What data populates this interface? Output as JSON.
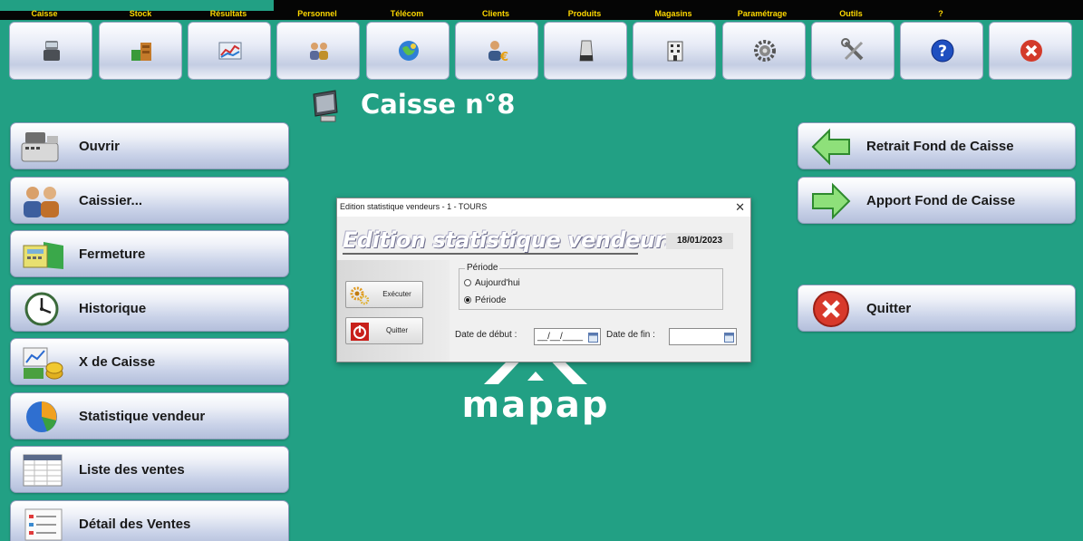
{
  "menu": [
    "Caisse",
    "Stock",
    "Résultats",
    "Personnel",
    "Télécom",
    "Clients",
    "Produits",
    "Magasins",
    "Paramétrage",
    "Outils",
    "?"
  ],
  "toolbar_icons": [
    "register-icon",
    "boxes-icon",
    "chart-icon",
    "people-icon",
    "globe-icon",
    "customer-euro-icon",
    "product-icon",
    "store-icon",
    "gear-icon",
    "tools-icon",
    "help-icon",
    "close-icon"
  ],
  "page_title": "Caisse n°8",
  "left_buttons": [
    {
      "label": "Ouvrir",
      "icon": "cash-register-icon"
    },
    {
      "label": "Caissier...",
      "icon": "cashiers-icon"
    },
    {
      "label": "Fermeture",
      "icon": "calculator-folder-icon"
    },
    {
      "label": "Historique",
      "icon": "clock-icon"
    },
    {
      "label": "X de Caisse",
      "icon": "money-chart-icon"
    },
    {
      "label": "Statistique vendeur",
      "icon": "pie-chart-icon"
    },
    {
      "label": "Liste des ventes",
      "icon": "spreadsheet-icon"
    },
    {
      "label": "Détail des Ventes",
      "icon": "document-icon"
    }
  ],
  "right_buttons": [
    {
      "label": "Retrait Fond de Caisse",
      "icon": "arrow-left-icon"
    },
    {
      "label": "Apport Fond de Caisse",
      "icon": "arrow-right-icon"
    },
    {
      "label": "Quitter",
      "icon": "close-icon"
    }
  ],
  "logo_text": "mapap",
  "dialog": {
    "window_title": "Edition statistique vendeurs - 1 - TOURS",
    "close_glyph": "✕",
    "heading": "Edition statistique vendeurs",
    "date": "18/01/2023",
    "execute_label": "Exécuter",
    "quit_label": "Quitter",
    "period_legend": "Période",
    "radio_today": "Aujourd'hui",
    "radio_period": "Période",
    "selected_radio": "Période",
    "start_label": "Date de début :",
    "start_value": "__/__/____",
    "end_label": "Date de fin :",
    "end_value": ""
  },
  "colors": {
    "background": "#22a084",
    "menu_text": "#ffd800",
    "menubar": "#050505"
  }
}
